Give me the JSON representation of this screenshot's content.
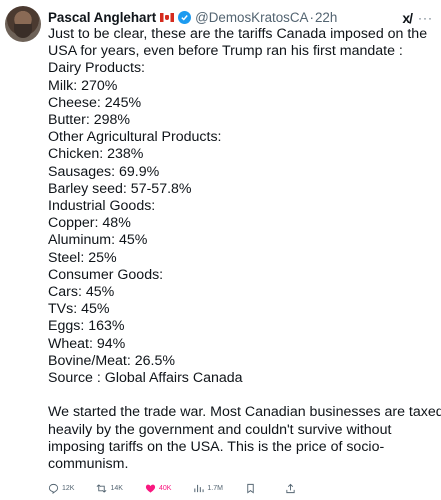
{
  "tweet": {
    "author_name": "Pascal Anglehart",
    "handle": "@DemosKratosCA",
    "separator": "·",
    "time": "22h",
    "grok_label": "x/",
    "more_label": "···",
    "lines": [
      "Just to be clear, these are the tariffs Canada imposed on the",
      "USA for years, even before Trump ran his first mandate :",
      "Dairy Products:",
      "Milk: 270%",
      "Cheese: 245%",
      "Butter: 298%",
      "Other Agricultural Products:",
      "Chicken: 238%",
      "Sausages: 69.9%",
      "Barley seed: 57-57.8%",
      "Industrial Goods:",
      "Copper: 48%",
      "Aluminum: 45%",
      "Steel: 25%",
      "Consumer Goods:",
      "Cars: 45%",
      "TVs: 45%",
      "Eggs: 163%",
      "Wheat: 94%",
      "Bovine/Meat: 26.5%",
      "Source : Global Affairs Canada"
    ],
    "closing_lines": [
      "We started the trade war. Most Canadian businesses are taxed",
      "heavily by the government and couldn't survive without",
      "imposing tariffs on the USA. This is the price of socio-",
      "communism."
    ]
  },
  "actions": {
    "replies": "12K",
    "reposts": "14K",
    "likes": "40K",
    "views": "1.7M"
  },
  "colors": {
    "verified": "#1d9bf0",
    "like": "#f91880",
    "secondary_text": "#536471"
  }
}
